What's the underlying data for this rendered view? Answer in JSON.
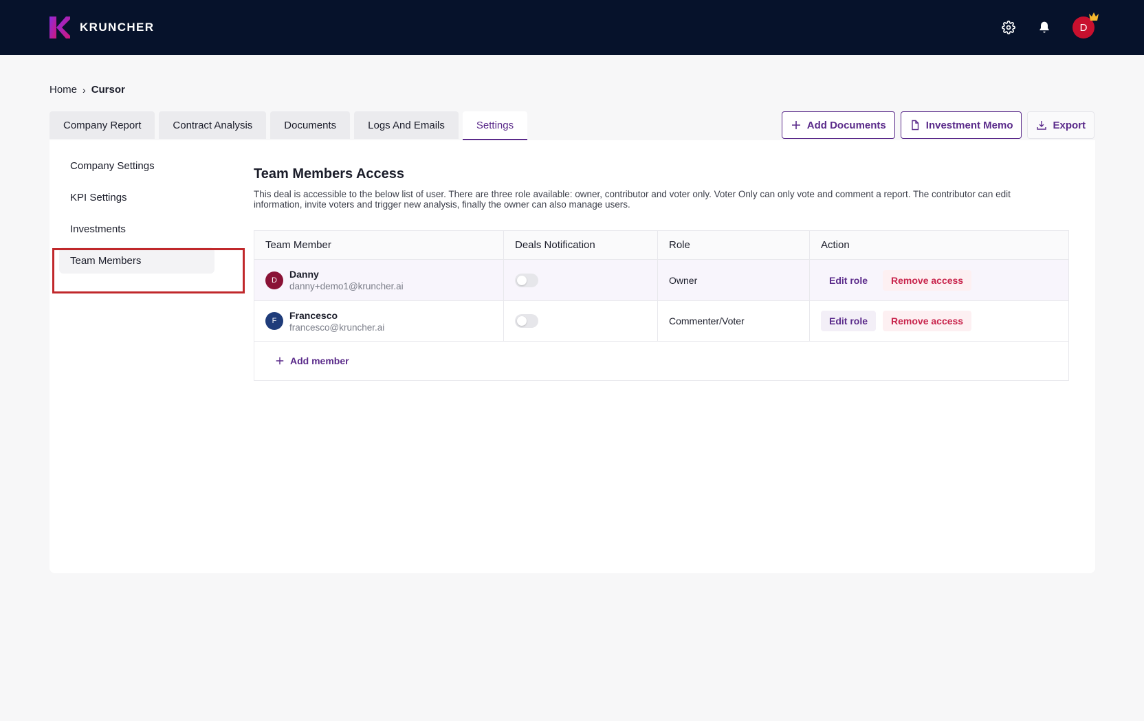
{
  "app": {
    "name": "KRUNCHER",
    "user_initial": "D"
  },
  "breadcrumb": {
    "home": "Home",
    "separator": "›",
    "current": "Cursor"
  },
  "tabs": [
    {
      "label": "Company Report"
    },
    {
      "label": "Contract Analysis"
    },
    {
      "label": "Documents"
    },
    {
      "label": "Logs And Emails"
    },
    {
      "label": "Settings",
      "active": true
    }
  ],
  "actions": {
    "add_documents": "Add Documents",
    "investment_memo": "Investment Memo",
    "export": "Export"
  },
  "sidebar": {
    "items": [
      {
        "label": "Company Settings"
      },
      {
        "label": "KPI Settings"
      },
      {
        "label": "Investments"
      },
      {
        "label": "Team Members",
        "active": true
      }
    ]
  },
  "section": {
    "title": "Team Members Access",
    "description": "This deal is accessible to the below list of user. There are three role available: owner, contributor and voter only. Voter Only can only vote and comment a report. The contributor can edit information, invite voters and trigger new analysis, finally the owner can also manage users."
  },
  "table": {
    "headers": {
      "member": "Team Member",
      "notification": "Deals Notification",
      "role": "Role",
      "action": "Action"
    },
    "rows": [
      {
        "initial": "D",
        "name": "Danny",
        "email": "danny+demo1@kruncher.ai",
        "notification": false,
        "role": "Owner",
        "edit": "Edit role",
        "remove": "Remove access"
      },
      {
        "initial": "F",
        "name": "Francesco",
        "email": "francesco@kruncher.ai",
        "notification": false,
        "role": "Commenter/Voter",
        "edit": "Edit role",
        "remove": "Remove access"
      }
    ],
    "add_member": "Add member"
  },
  "colors": {
    "brand": "#5a2a8a",
    "topbar": "#06122b",
    "danger": "#c8234b",
    "highlight": "#c0282b"
  }
}
